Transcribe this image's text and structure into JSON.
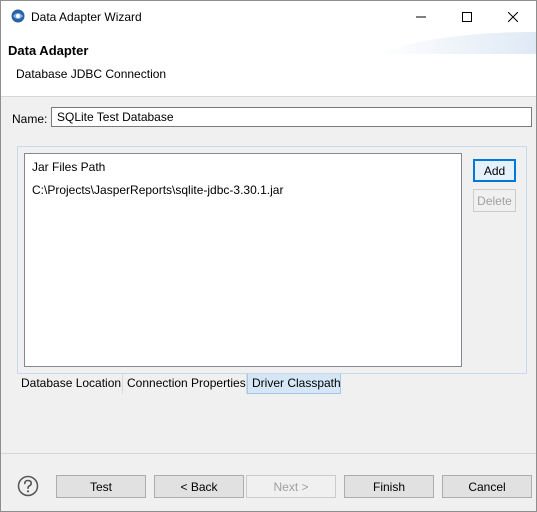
{
  "window": {
    "title": "Data Adapter Wizard",
    "icon": "jaspersoft-app-icon"
  },
  "header": {
    "title": "Data Adapter",
    "subtitle": "Database JDBC Connection"
  },
  "name_field": {
    "label": "Name:",
    "value": "SQLite Test Database"
  },
  "classpath": {
    "column_header": "Jar Files Path",
    "items": [
      "C:\\Projects\\JasperReports\\sqlite-jdbc-3.30.1.jar"
    ],
    "add_label": "Add",
    "delete_label": "Delete"
  },
  "tabs": [
    {
      "label": "Database Location",
      "active": false
    },
    {
      "label": "Connection Properties",
      "active": false
    },
    {
      "label": "Driver Classpath",
      "active": true
    }
  ],
  "footer": {
    "test_label": "Test",
    "back_label": "< Back",
    "next_label": "Next >",
    "finish_label": "Finish",
    "cancel_label": "Cancel",
    "help_icon": "help-icon"
  },
  "colors": {
    "accent": "#0078d7",
    "active_tab": "#d5e7f6"
  }
}
